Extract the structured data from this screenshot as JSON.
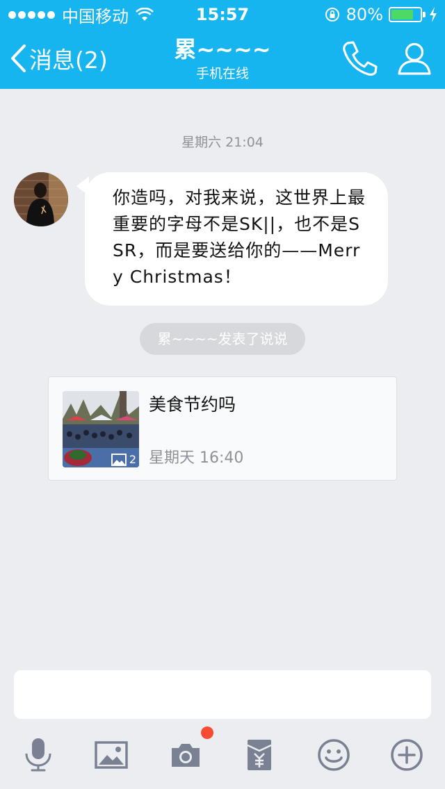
{
  "status_bar": {
    "carrier": "中国移动",
    "time": "15:57",
    "battery_percent": "80%",
    "battery_level": 0.8,
    "icons": [
      "signal-dots-icon",
      "wifi-icon",
      "orientation-lock-icon",
      "battery-icon",
      "charging-bolt-icon"
    ]
  },
  "header": {
    "back_label": "消息(2)",
    "title": "累~~~~",
    "subtitle": "手机在线",
    "actions": [
      "phone-icon",
      "profile-icon"
    ]
  },
  "chat": {
    "timestamp": "星期六 21:04",
    "message_text": "你造吗，对我来说，这世界上最重要的字母不是SK||，也不是SSR，而是要送给你的——Merry Christmas！",
    "notice": "累~~~~发表了说说",
    "feed_card": {
      "title": "美食节约吗",
      "time": "星期天 16:40",
      "photo_count": "2"
    }
  },
  "input": {
    "placeholder": ""
  },
  "toolbar": {
    "items": [
      "microphone-icon",
      "image-icon",
      "camera-icon",
      "red-packet-icon",
      "emoji-icon",
      "plus-icon"
    ],
    "camera_has_notification": true
  },
  "colors": {
    "header_blue": "#16b5f0",
    "background": "#ebedf1",
    "battery_green": "#4cd964",
    "notification_red": "#f74c31",
    "icon_gray": "#7a8193"
  }
}
